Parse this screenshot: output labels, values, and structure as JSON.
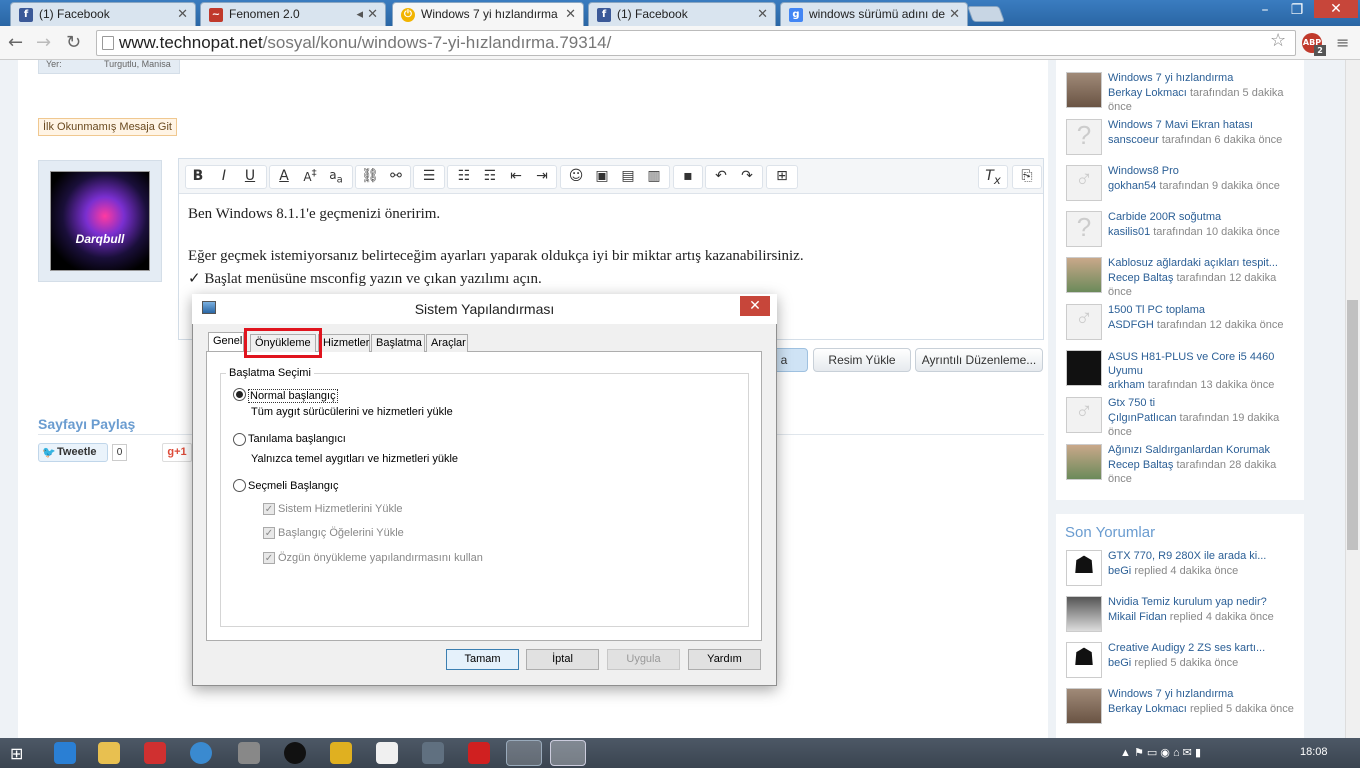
{
  "browser": {
    "tabs": [
      {
        "label": "(1) Facebook",
        "icon": "facebook-icon",
        "color": "#3b5998",
        "active": false
      },
      {
        "label": "Fenomen 2.0",
        "icon": "fenomen-icon",
        "color": "#c0392b",
        "active": false
      },
      {
        "label": "Windows 7 yi hızlandırma",
        "icon": "technopat-icon",
        "color": "#f2b400",
        "active": true
      },
      {
        "label": "(1) Facebook",
        "icon": "facebook-icon",
        "color": "#3b5998",
        "active": false
      },
      {
        "label": "windows sürümü adını de",
        "icon": "google-icon",
        "color": "#4285f4",
        "active": false
      }
    ],
    "url_host": "www.technopat.net",
    "url_path": "/sosyal/konu/windows-7-yi-hızlandırma.79314/",
    "extension_badge": "ABP",
    "extension_count": "2"
  },
  "post": {
    "location_label": "Yer:",
    "location_value": "Turgutlu, Manisa",
    "unread_link": "İlk Okunmamış Mesaja Git",
    "avatar_name": "Darqbull",
    "share_title": "Sayfayı Paylaş",
    "tweet_label": "Tweetle",
    "tweet_count": "0",
    "gplus_label": "+1"
  },
  "editor": {
    "lines": [
      "Ben Windows 8.1.1'e geçmenizi öneririm.",
      "Eğer geçmek istemiyorsanız belirteceğim ayarları yaparak oldukça iyi bir miktar artış kazanabilirsiniz.",
      "✓ Başlat menüsüne msconfig yazın ve çıkan yazılımı açın."
    ],
    "btn_image_upload": "Resim Yükle",
    "btn_advanced": "Ayrıntılı Düzenleme...",
    "btn_partial": "a"
  },
  "sidebar": {
    "recent_threads": [
      {
        "title": "Windows 7 yi hızlandırma",
        "user": "Berkay Lokmacı",
        "meta": "tarafından 5 dakika önce"
      },
      {
        "title": "Windows 7 Mavi Ekran hatası",
        "user": "sanscoeur",
        "meta": "tarafından 6 dakika önce"
      },
      {
        "title": "Windows8 Pro",
        "user": "gokhan54",
        "meta": "tarafından 9 dakika önce"
      },
      {
        "title": "Carbide 200R soğutma",
        "user": "kasilis01",
        "meta": "tarafından 10 dakika önce"
      },
      {
        "title": "Kablosuz ağlardaki açıkları tespit...",
        "user": "Recep Baltaş",
        "meta": "tarafından 12 dakika önce"
      },
      {
        "title": "1500 Tl PC toplama",
        "user": "ASDFGH",
        "meta": "tarafından 12 dakika önce"
      },
      {
        "title": "ASUS H81-PLUS ve Core i5 4460 Uyumu",
        "user": "arkham",
        "meta": "tarafından 13 dakika önce"
      },
      {
        "title": "Gtx 750 ti",
        "user": "ÇılgınPatlıcan",
        "meta": "tarafından 19 dakika önce"
      },
      {
        "title": "Ağınızı Saldırganlardan Korumak",
        "user": "Recep Baltaş",
        "meta": "tarafından 28 dakika önce"
      }
    ],
    "comments_title": "Son Yorumlar",
    "comments": [
      {
        "title": "GTX 770, R9 280X ile arada ki...",
        "user": "beGi",
        "meta": "replied 4 dakika önce"
      },
      {
        "title": "Nvidia Temiz kurulum yap nedir?",
        "user": "Mikail Fidan",
        "meta": "replied 4 dakika önce"
      },
      {
        "title": "Creative Audigy 2 ZS ses kartı...",
        "user": "beGi",
        "meta": "replied 5 dakika önce"
      },
      {
        "title": "Windows 7 yi hızlandırma",
        "user": "Berkay Lokmacı",
        "meta": "replied 5 dakika önce"
      }
    ]
  },
  "dialog": {
    "title": "Sistem Yapılandırması",
    "tabs": [
      "Genel",
      "Önyükleme",
      "Hizmetler",
      "Başlatma",
      "Araçlar"
    ],
    "group_title": "Başlatma Seçimi",
    "normal_label": "Normal başlangıç",
    "normal_desc": "Tüm aygıt sürücülerini ve hizmetleri yükle",
    "diag_label": "Tanılama başlangıcı",
    "diag_desc": "Yalnızca temel aygıtları ve hizmetleri yükle",
    "selective_label": "Seçmeli Başlangıç",
    "chk_services": "Sistem Hizmetlerini Yükle",
    "chk_startup": "Başlangıç Öğelerini Yükle",
    "chk_boot": "Özgün önyükleme yapılandırmasını kullan",
    "btn_ok": "Tamam",
    "btn_cancel": "İptal",
    "btn_apply": "Uygula",
    "btn_help": "Yardım"
  },
  "taskbar": {
    "time": "18:08"
  }
}
